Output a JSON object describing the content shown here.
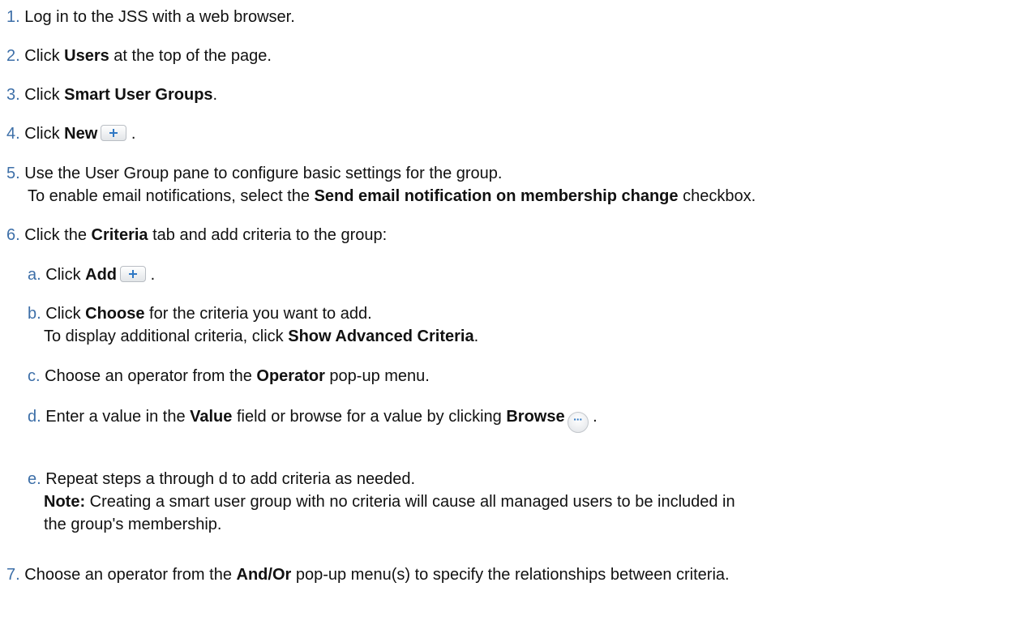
{
  "steps": {
    "s1": {
      "num": "1.",
      "text": "Log in to the JSS with a web browser."
    },
    "s2": {
      "num": "2.",
      "pre": "Click ",
      "bold": "Users",
      "post": " at the top of the page."
    },
    "s3": {
      "num": "3.",
      "pre": "Click ",
      "bold": "Smart User Groups",
      "post": "."
    },
    "s4": {
      "num": "4.",
      "pre": "Click ",
      "bold": "New",
      "post": " .",
      "icon": "plus-icon"
    },
    "s5": {
      "num": "5.",
      "line1": "Use the User Group pane to configure basic settings for the group.",
      "line2_pre": "To enable email notifications, select the ",
      "line2_bold": "Send email notification on membership change",
      "line2_post": " checkbox."
    },
    "s6": {
      "num": "6.",
      "pre": "Click the ",
      "bold": "Criteria",
      "post": " tab and add criteria to the group:"
    },
    "s7": {
      "num": "7.",
      "pre": "Choose an operator from the ",
      "bold": "And/Or",
      "post": " pop-up menu(s) to specify the relationships between criteria."
    }
  },
  "substeps": {
    "a": {
      "num": "a.",
      "pre": "Click ",
      "bold": "Add",
      "post": " .",
      "icon": "plus-icon"
    },
    "b": {
      "num": "b.",
      "line1_pre": "Click ",
      "line1_bold": "Choose",
      "line1_post": " for the criteria you want to add.",
      "line2_pre": "To display additional criteria, click ",
      "line2_bold": "Show Advanced Criteria",
      "line2_post": "."
    },
    "c": {
      "num": "c.",
      "pre": "Choose an operator from the ",
      "bold": "Operator",
      "post": " pop-up menu."
    },
    "d": {
      "num": "d.",
      "pre": "Enter a value in the ",
      "bold": "Value",
      "mid": " field or browse for a value by clicking ",
      "bold2": "Browse",
      "post": " .",
      "icon": "ellipsis-icon",
      "icon_glyph": "···"
    },
    "e": {
      "num": "e.",
      "line1": "Repeat steps a through d to add criteria as needed.",
      "note_label": "Note:",
      "note_text": " Creating a smart user group with no criteria will cause all managed users to be included in",
      "note_line2": "the group's membership."
    }
  },
  "colors": {
    "number": "#3d6fa8",
    "text": "#111111",
    "icon_blue": "#2f78c4"
  }
}
